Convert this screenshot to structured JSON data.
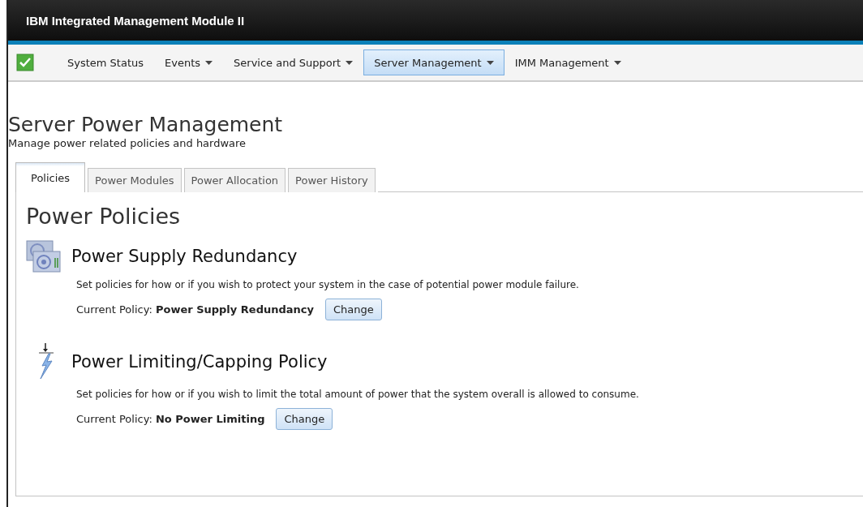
{
  "header": {
    "title": "IBM Integrated Management Module II"
  },
  "nav": {
    "status_ok": true,
    "items": [
      {
        "label": "System Status",
        "has_menu": false,
        "selected": false
      },
      {
        "label": "Events",
        "has_menu": true,
        "selected": false
      },
      {
        "label": "Service and Support",
        "has_menu": true,
        "selected": false
      },
      {
        "label": "Server Management",
        "has_menu": true,
        "selected": true
      },
      {
        "label": "IMM Management",
        "has_menu": true,
        "selected": false
      }
    ]
  },
  "page": {
    "title": "Server Power Management",
    "subtitle": "Manage power related policies and hardware"
  },
  "tabs": [
    {
      "label": "Policies",
      "selected": true
    },
    {
      "label": "Power Modules",
      "selected": false
    },
    {
      "label": "Power Allocation",
      "selected": false
    },
    {
      "label": "Power History",
      "selected": false
    }
  ],
  "panel": {
    "title": "Power Policies",
    "sections": [
      {
        "kind": "redundancy",
        "title": "Power Supply Redundancy",
        "description": "Set policies for how or if you wish to protect your system in the case of potential power module failure.",
        "policy": "Current Policy: **Power Supply Redundancy**",
        "button": "Change"
      },
      {
        "kind": "capping",
        "title": "Power Limiting/Capping Policy",
        "description": "Set policies for how or if you wish to limit the total amount of power that the system overall is allowed to consume.",
        "policy": "Current Policy: **No Power Limiting**",
        "button": "Change"
      }
    ]
  }
}
